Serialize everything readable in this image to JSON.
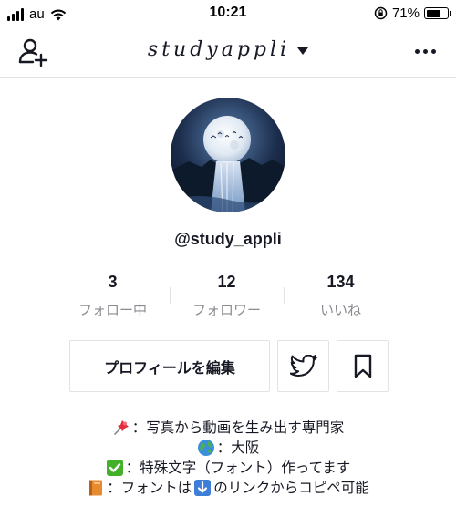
{
  "status_bar": {
    "carrier": "au",
    "time": "10:21",
    "battery_percent": "71%",
    "battery_level": 0.71
  },
  "header": {
    "title": "studyappli",
    "add_user_icon": "person-add-icon",
    "dropdown_icon": "caret-down-icon",
    "more_icon": "more-horizontal-icon"
  },
  "profile": {
    "username": "@study_appli",
    "avatar_icon": "moon-waterfall-avatar"
  },
  "stats": [
    {
      "value": "3",
      "label": "フォロー中"
    },
    {
      "value": "12",
      "label": "フォロワー"
    },
    {
      "value": "134",
      "label": "いいね"
    }
  ],
  "buttons": {
    "edit_profile": "プロフィールを編集",
    "twitter_icon": "twitter-icon",
    "bookmark_icon": "bookmark-icon"
  },
  "bio": [
    {
      "icon": "pushpin-icon",
      "text": "：写真から動画を生み出す専門家"
    },
    {
      "icon": "globe-icon",
      "text": "：大阪"
    },
    {
      "icon": "check-mark-icon",
      "text": "：特殊文字（フォント）作ってます"
    },
    {
      "icon": "orange-book-icon",
      "text": "：フォントは",
      "icon2": "down-arrow-icon",
      "text2": "のリンクからコピペ可能"
    }
  ],
  "colors": {
    "text": "#161823",
    "secondary_text": "#8a8b91",
    "border": "#e3e3e4",
    "check_green": "#43b02a"
  }
}
